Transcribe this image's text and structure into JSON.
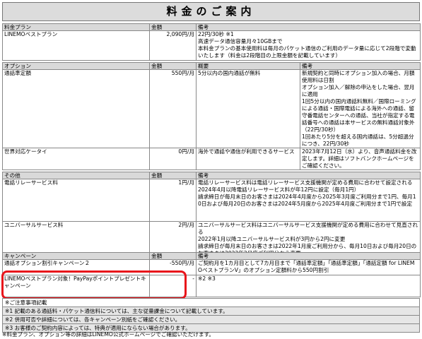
{
  "page": {
    "title": "料金のご案内"
  },
  "plan": {
    "headers": [
      "料金プラン",
      "金額",
      "備考"
    ],
    "rows": [
      {
        "name": "LINEMOベストプラン",
        "price": "2,090円/月",
        "remarks": "22円/30秒 ※1\n高速データ通信容量月々10GBまで\n本料金プランの基本使用料は毎月のパケット通信のご利用のデータ量に応じて2段階で変動いたします（料金は2段階目の上限金額を記載しています）"
      }
    ]
  },
  "options": {
    "headers": [
      "オプション",
      "金額",
      "概要",
      "備考"
    ],
    "rows": [
      {
        "name": "通話準定額",
        "price": "550円/月",
        "summary": "5分以内の国内通話が無料",
        "remarks": "新規契約と同時にオプション加入の場合、月額使用料は日割\nオプション加入／解除の申込をした場合、翌月に適用\n1回5分以内の国内通話料無料／国際ローミングによる通話・国際電話による海外への通話、留守番電話センターへの通話、当社が指定する電話番号への通話は本サービスの無料通話対象外（22円/30秒）\n1回あたり5分を超える国内通話は、5分超過分につき、22円/30秒"
      },
      {
        "name": "世界対応ケータイ",
        "price": "0円/月",
        "summary": "海外で通話や通信が利用できるサービス",
        "remarks": "2023年7月12日（水）より、音声通話料金を改定します。詳細はソフトバンクホームページをご確認ください。"
      }
    ]
  },
  "others": {
    "headers": [
      "その他",
      "金額",
      "備考"
    ],
    "rows": [
      {
        "name": "電話リレーサービス料",
        "price": "1円/月",
        "remarks": "電話リレーサービス料は電話リレーサービス支援機関が定める費用に合わせて設定される\n2024年4月以降電話リレーサービス料が年12円に設定（毎月1円）\n請求締日が毎月末日のお客さまは2024年4月度から2025年3月度ご利用分まで1円、毎月10日および毎月20日のお客さまは2024年5月度から2025年4月度ご利用分まで1円で設定"
      },
      {
        "name": "ユニバーサルサービス料",
        "price": "2円/月",
        "remarks": "ユニバーサルサービス料はユニバーサルサービス支援機関が定める費用に合わせて見直される\n2022年1月以降ユニバーサルサービス料が3円から2円に変更\n請求締日が毎月末日のお客さまは2022年1月度ご利用分から、毎月10日および毎月20日のお客さまは2022年2月度ご利用分から変更"
      }
    ]
  },
  "campaign": {
    "headers": [
      "キャンペーン",
      "金額",
      "備考"
    ],
    "rows": [
      {
        "name": "通話オプション割引キャンペーン２",
        "price": "-550円/月",
        "remarks": "ご契約月を1カ月目として7カ月目まで「通話準定額」「通話準定額」「通話定額 for LINEMOベストプランV」のオプション定額料から550円割引"
      },
      {
        "name": "LINEMOベストプラン対象！PayPayポイントプレゼントキャンペーン",
        "price": "-",
        "remarks": "※2 ※3"
      }
    ]
  },
  "notes": {
    "items": [
      "※ご注意事項記載",
      "※1 記載のある通話料・パケット通信料については、主な従量課金について記載しています。",
      "※2 併用可否や詳細については、各キャンペーン別紙をご確認ください。",
      "※3 お客様のご契約内容によっては、特典が適用にならない場合があります。"
    ],
    "footer": "※料金プラン、オプション等の詳細はLINEMO公式ホームページでご確認いただけます。"
  },
  "colors": {
    "header_gray": "#d9d9d9",
    "highlight_red": "#e8141b"
  }
}
